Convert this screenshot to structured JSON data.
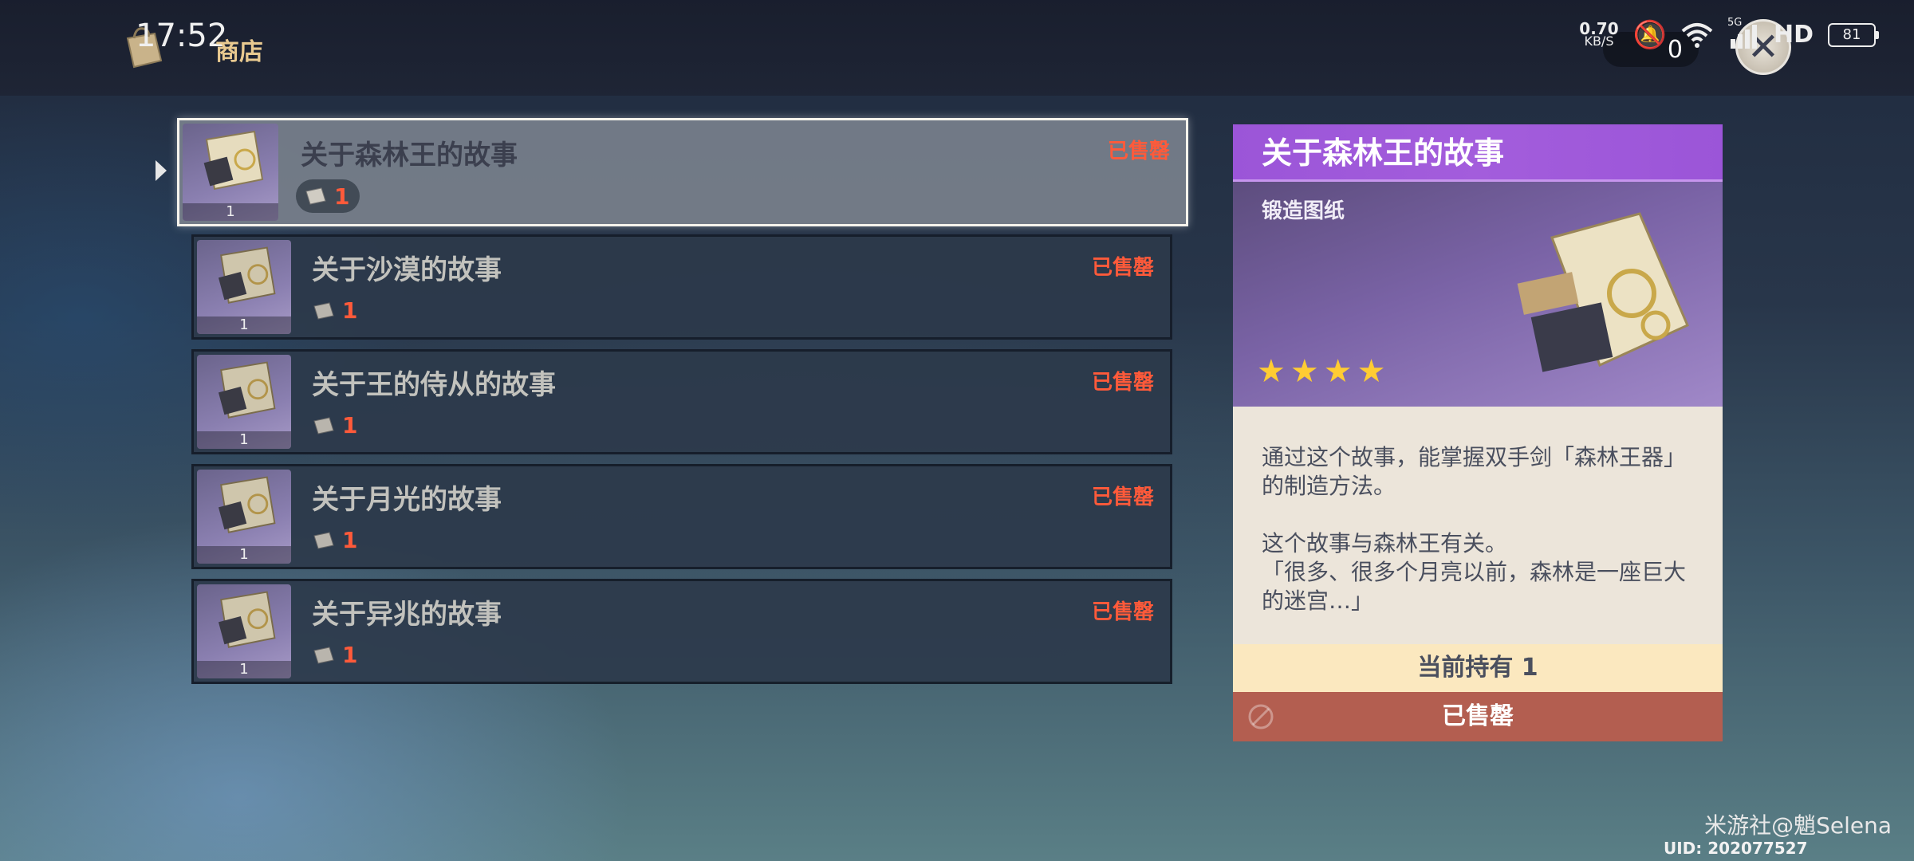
{
  "status_bar": {
    "time": "17:52",
    "net_speed_value": "0.70",
    "net_speed_unit": "KB/S",
    "signal_label": "5G",
    "hd": "HD",
    "battery": "81"
  },
  "header": {
    "title": "商店",
    "currency_amount": "0"
  },
  "items": [
    {
      "name": "关于森林王的故事",
      "status": "已售罄",
      "cost": "1",
      "owned": "1",
      "selected": true
    },
    {
      "name": "关于沙漠的故事",
      "status": "已售罄",
      "cost": "1",
      "owned": "1",
      "selected": false
    },
    {
      "name": "关于王的侍从的故事",
      "status": "已售罄",
      "cost": "1",
      "owned": "1",
      "selected": false
    },
    {
      "name": "关于月光的故事",
      "status": "已售罄",
      "cost": "1",
      "owned": "1",
      "selected": false
    },
    {
      "name": "关于异兆的故事",
      "status": "已售罄",
      "cost": "1",
      "owned": "1",
      "selected": false
    }
  ],
  "detail": {
    "title": "关于森林王的故事",
    "type": "锻造图纸",
    "rarity": 4,
    "desc_1": "通过这个故事，能掌握双手剑「森林王器」的制造方法。",
    "desc_2": "这个故事与森林王有关。",
    "desc_3": "「很多、很多个月亮以前，森林是一座巨大的迷宫…」",
    "held_label": "当前持有 1",
    "soldout_label": "已售罄"
  },
  "watermark": "米游社@魈Selena",
  "uid": "UID: 202077527",
  "colors": {
    "accent_purple": "#9b55d8",
    "soldout_red": "#ff5a3a",
    "star_gold": "#ffcc33"
  }
}
